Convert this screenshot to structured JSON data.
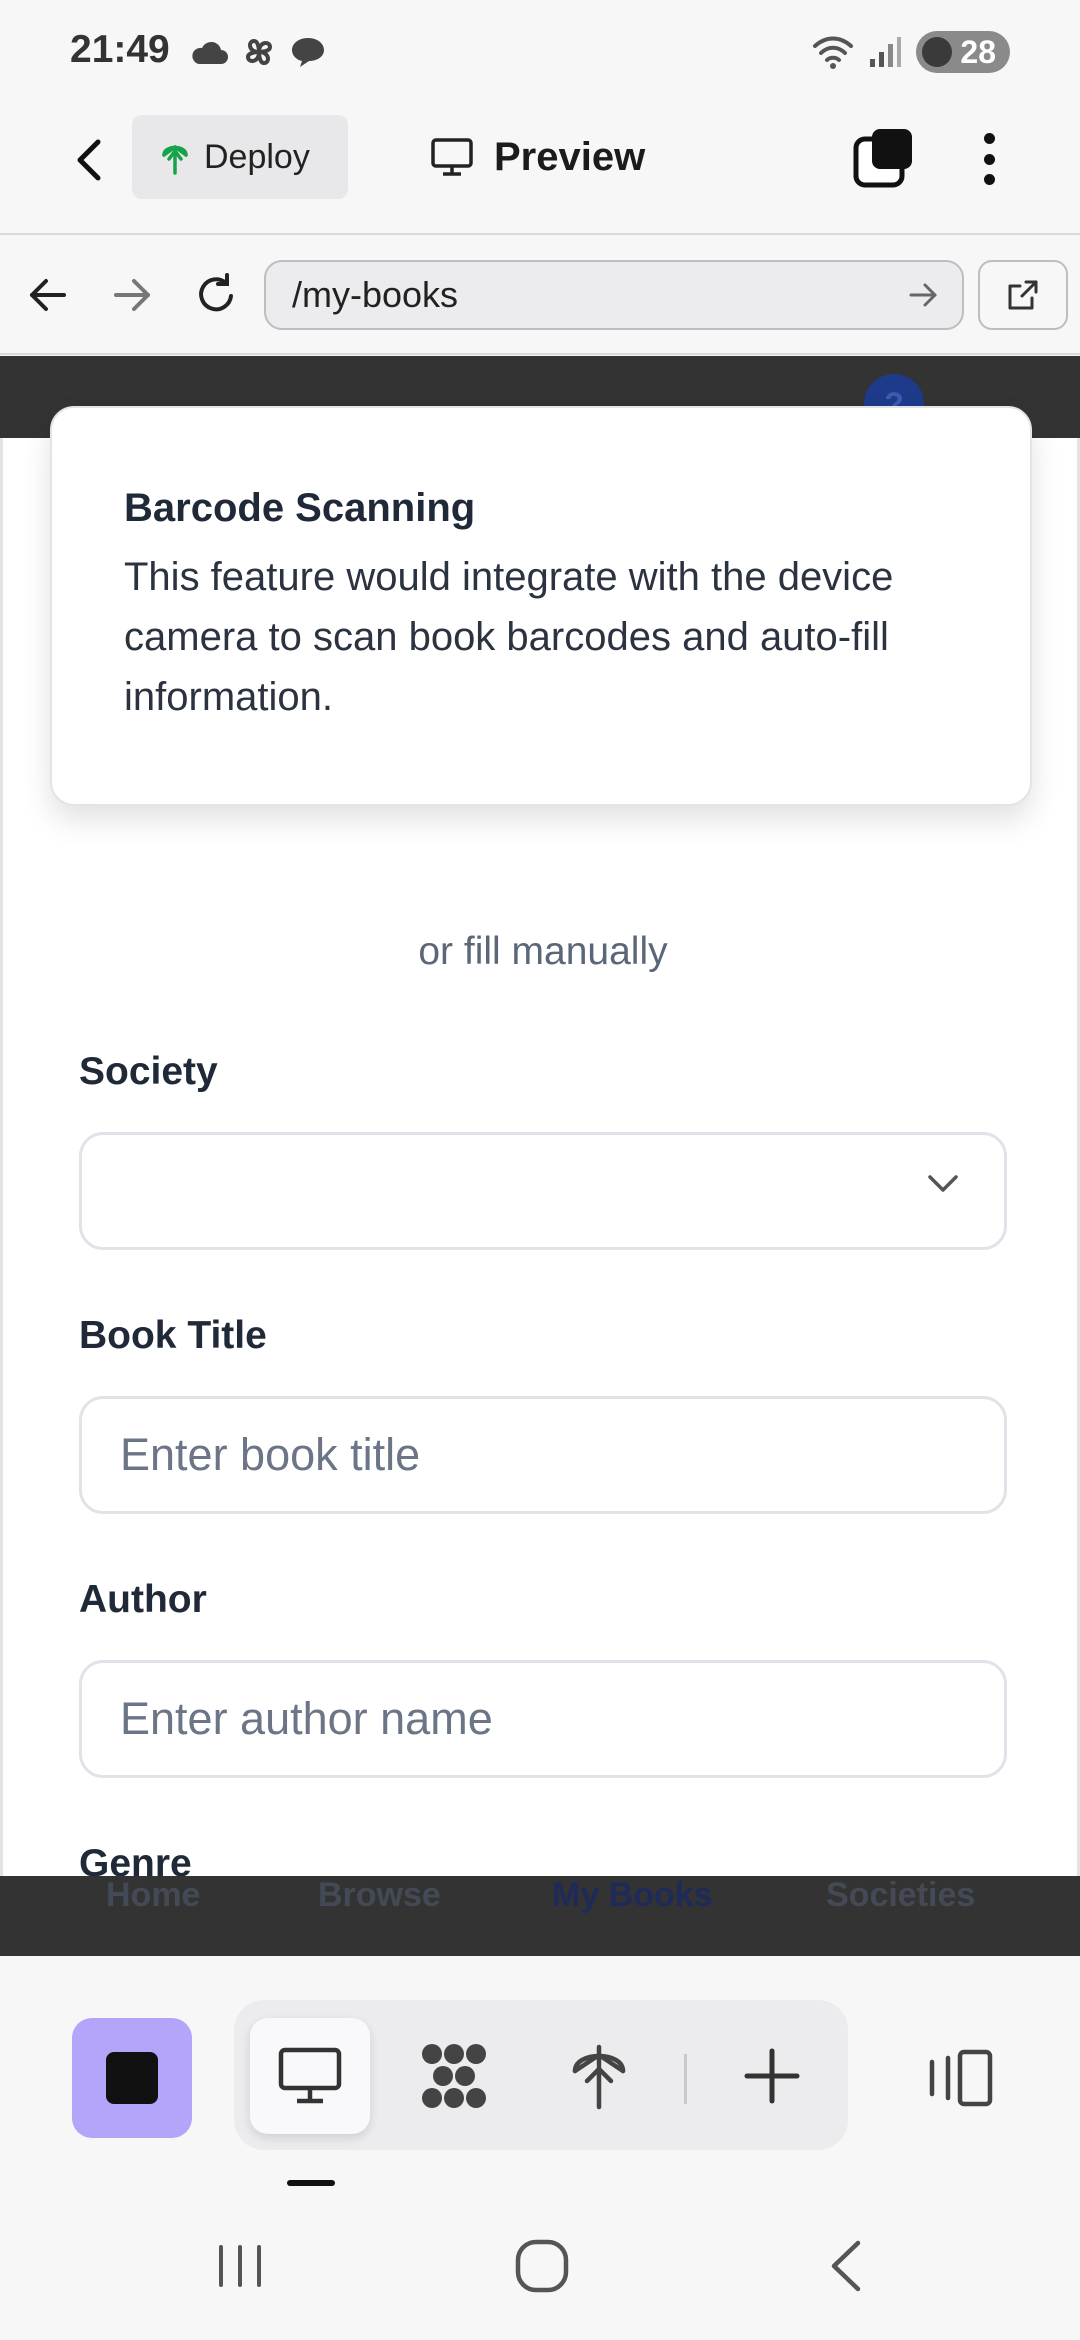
{
  "status_bar": {
    "time": "21:49",
    "battery": "28",
    "left_icons": [
      "cloud-icon",
      "pinwheel-icon",
      "chat-bubble-icon"
    ],
    "right_icons": [
      "wifi-icon",
      "signal-icon",
      "battery-icon"
    ]
  },
  "app_bar": {
    "deploy_label": "Deploy",
    "preview_label": "Preview"
  },
  "browser": {
    "url": "/my-books"
  },
  "toast": {
    "title": "Barcode Scanning",
    "body": "This feature would integrate with the device camera to scan book barcodes and auto-fill information."
  },
  "form": {
    "divider_text": "or fill manually",
    "society_label": "Society",
    "society_value": "",
    "title_label": "Book Title",
    "title_placeholder": "Enter book title",
    "author_label": "Author",
    "author_placeholder": "Enter author name",
    "genre_label": "Genre"
  },
  "app_nav": {
    "items": [
      "Home",
      "Browse",
      "My Books",
      "Societies"
    ],
    "active": "My Books"
  },
  "colors": {
    "accent": "#b4a5fb",
    "header_dark": "#333333",
    "label_text": "#1f2937",
    "placeholder_text": "#6b7586"
  }
}
